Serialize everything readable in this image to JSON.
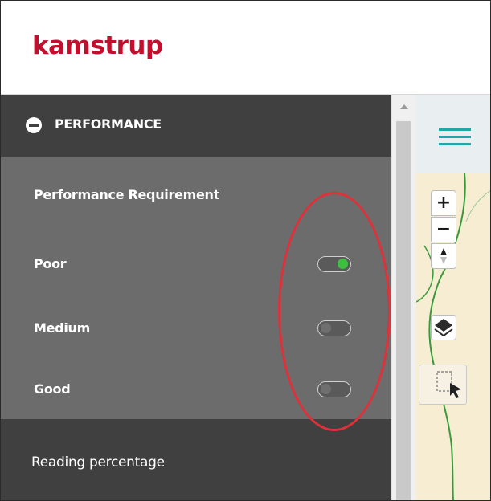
{
  "header": {
    "logo_text": "kamstrup",
    "logo_color": "#c0102e"
  },
  "sidebar": {
    "section": {
      "icon": "collapse-minus-icon",
      "title": "PERFORMANCE"
    },
    "panel": {
      "title": "Performance Requirement",
      "options": [
        {
          "label": "Poor",
          "enabled": true
        },
        {
          "label": "Medium",
          "enabled": false
        },
        {
          "label": "Good",
          "enabled": false
        }
      ]
    },
    "next_item": {
      "label": "Reading percentage"
    }
  },
  "map": {
    "toolbar": {
      "menu_icon": "hamburger-menu-icon"
    },
    "controls": {
      "zoom_in": "+",
      "zoom_out": "−",
      "compass_icon": "compass-arrow-icon",
      "layers_icon": "layers-icon",
      "select_icon": "box-select-cursor-icon"
    }
  },
  "colors": {
    "sidebar_dark": "#404040",
    "panel_gray": "#6c6c6c",
    "toggle_on": "#3fbf3f",
    "accent_teal": "#22a6a6",
    "annotation_red": "#e0303a"
  }
}
